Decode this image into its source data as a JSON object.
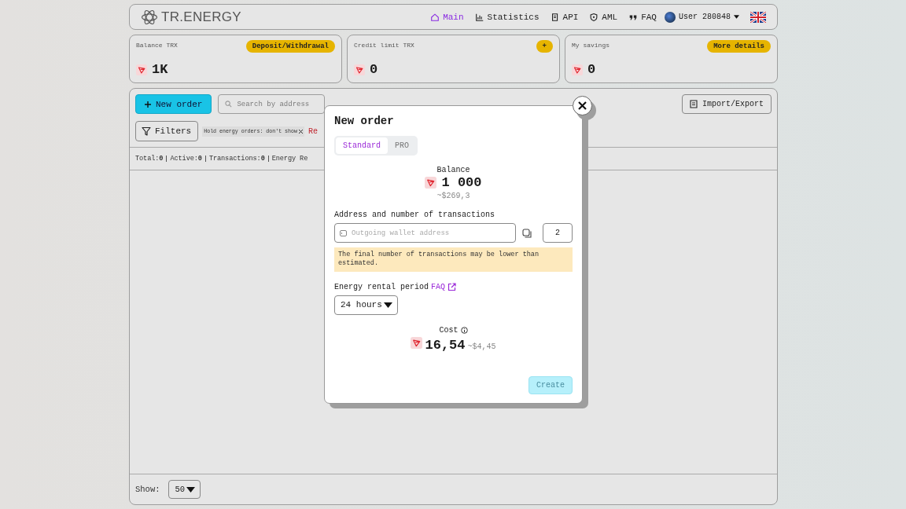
{
  "header": {
    "logo": "TR.ENERGY",
    "nav": [
      {
        "label": "Main",
        "kind": "home",
        "selected": true
      },
      {
        "label": "Statistics",
        "kind": "chart",
        "selected": false
      },
      {
        "label": "API",
        "kind": "doc",
        "selected": false
      },
      {
        "label": "AML",
        "kind": "shield",
        "selected": false
      },
      {
        "label": "FAQ",
        "kind": "quote",
        "selected": false
      }
    ],
    "user": "User 280848"
  },
  "cards": [
    {
      "title": "Balance TRX",
      "action": "Deposit/Withdrawal",
      "value": "1K"
    },
    {
      "title": "Credit limit TRX",
      "action": "+",
      "value": "0"
    },
    {
      "title": "My savings",
      "action": "More details",
      "value": "0"
    }
  ],
  "toolbar": {
    "new_order": "New order",
    "search_placeholder": "Search by address",
    "import_export": "Import/Export",
    "filters": "Filters",
    "filter_chip": "Hold energy orders: don't show",
    "reset": "Re"
  },
  "stats": [
    {
      "label": "Total:",
      "value": "0"
    },
    {
      "label": "Active:",
      "value": "0"
    },
    {
      "label": "Transactions:",
      "value": "0"
    },
    {
      "label": "Energy Re"
    }
  ],
  "footer": {
    "show_label": "Show:",
    "page_size": "50"
  },
  "modal": {
    "title": "New order",
    "tabs": [
      {
        "label": "Standard",
        "selected": true
      },
      {
        "label": "PRO",
        "selected": false
      }
    ],
    "balance_label": "Balance",
    "balance": "1 000",
    "balance_usd": "~$269,3",
    "address_label": "Address and number of transactions",
    "address_placeholder": "Outgoing wallet address",
    "tx_count": "2",
    "warning": "The final number of transactions may be lower than estimated.",
    "period_label": "Energy rental period",
    "faq_link": "FAQ",
    "period": "24 hours",
    "cost_label": "Cost",
    "cost": "16,54",
    "cost_usd": "~$4,45",
    "create": {
      "label": "Create",
      "disabled": true
    }
  }
}
